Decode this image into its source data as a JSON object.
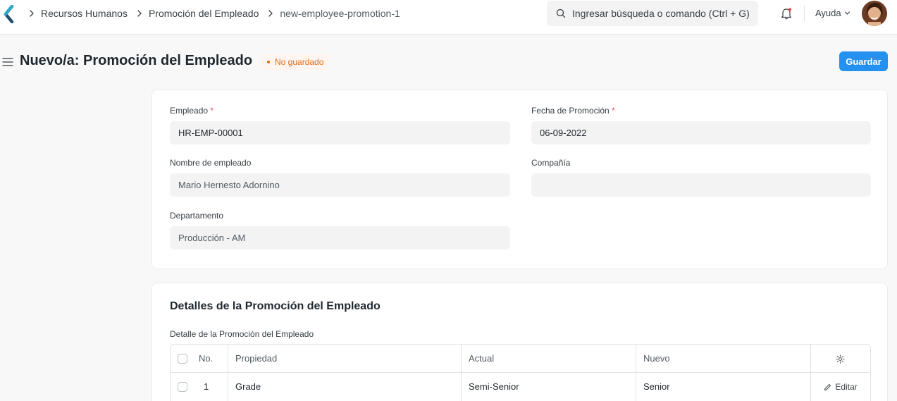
{
  "navbar": {
    "breadcrumbs": [
      "Recursos Humanos",
      "Promoción del Empleado",
      "new-employee-promotion-1"
    ],
    "search_placeholder": "Ingresar búsqueda o comando (Ctrl + G)",
    "help_label": "Ayuda"
  },
  "page": {
    "title": "Nuevo/a: Promoción del Empleado",
    "status_badge": "No guardado",
    "save_label": "Guardar"
  },
  "form": {
    "employee_label": "Empleado",
    "employee_value": "HR-EMP-00001",
    "promotion_date_label": "Fecha de Promoción",
    "promotion_date_value": "06-09-2022",
    "employee_name_label": "Nombre de empleado",
    "employee_name_value": "Mario Hernesto Adornino",
    "company_label": "Compañía",
    "company_value": "",
    "department_label": "Departamento",
    "department_value": "Producción - AM",
    "required_mark": "*"
  },
  "details": {
    "section_title": "Detalles de la Promoción del Empleado",
    "table_label": "Detalle de la Promoción del Empleado",
    "columns": [
      "No.",
      "Propiedad",
      "Actual",
      "Nuevo"
    ],
    "rows": [
      {
        "no": "1",
        "property": "Grade",
        "current": "Semi-Senior",
        "new": "Senior",
        "edit_label": "Editar"
      }
    ]
  },
  "colors": {
    "primary": "#2490ef",
    "unsaved": "#e86c13",
    "required": "#e24c4c"
  }
}
